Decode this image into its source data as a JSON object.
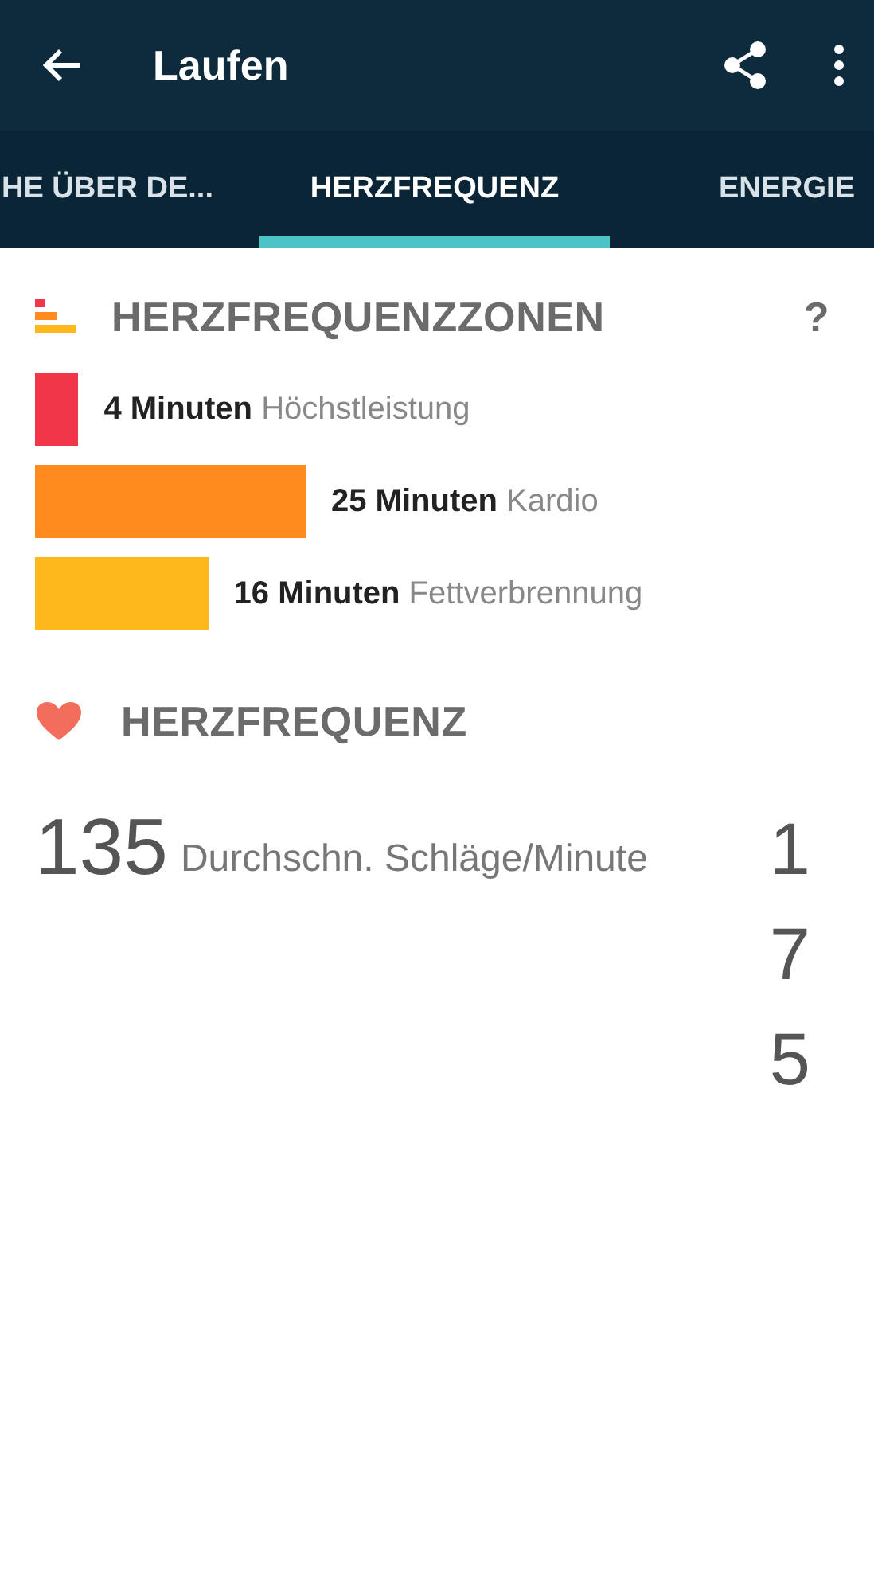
{
  "app_bar": {
    "title": "Laufen"
  },
  "tabs": [
    {
      "label": "HE ÜBER DE...",
      "selected": false
    },
    {
      "label": "HERZFREQUENZ",
      "selected": true
    },
    {
      "label": "ENERGIE",
      "selected": false
    }
  ],
  "zones_section": {
    "title": "HERZFREQUENZZONEN",
    "help": "?",
    "zones": [
      {
        "value": "4 Minuten",
        "label": "Höchstleistung",
        "color": "#f2364a"
      },
      {
        "value": "25 Minuten",
        "label": "Kardio",
        "color": "#ff8b1e"
      },
      {
        "value": "16 Minuten",
        "label": "Fettverbrennung",
        "color": "#ffb81c"
      }
    ]
  },
  "heart_rate_section": {
    "title": "HERZFREQUENZ",
    "average": "135",
    "average_label": "Durchschn. Schläge/Minute",
    "column_2": "175"
  }
}
